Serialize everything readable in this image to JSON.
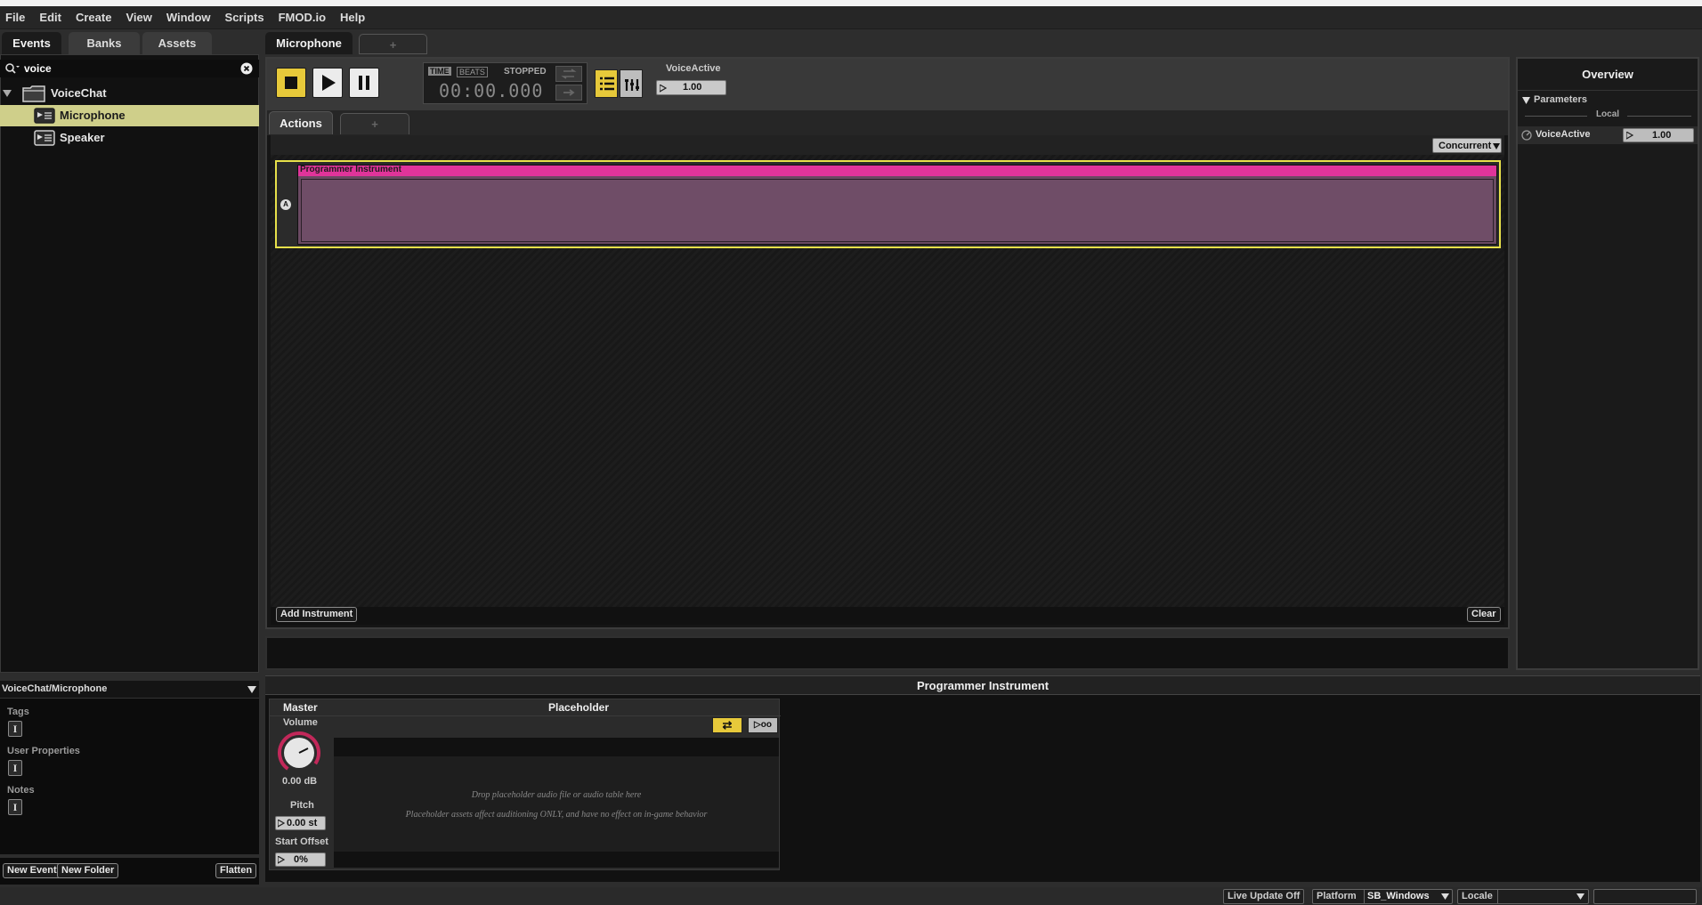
{
  "menu": [
    "File",
    "Edit",
    "Create",
    "View",
    "Window",
    "Scripts",
    "FMOD.io",
    "Help"
  ],
  "browser": {
    "tabs": [
      "Events",
      "Banks",
      "Assets"
    ],
    "search_value": "voice",
    "tree": [
      {
        "label": "VoiceChat",
        "type": "folder"
      },
      {
        "label": "Microphone",
        "type": "event",
        "selected": true
      },
      {
        "label": "Speaker",
        "type": "event"
      }
    ]
  },
  "properties": {
    "path": "VoiceChat/Microphone",
    "tags_label": "Tags",
    "user_props_label": "User Properties",
    "notes_label": "Notes",
    "prop_btn_glyph": "I"
  },
  "browser_footer": {
    "new_event": "New Event",
    "new_folder": "New Folder",
    "flatten": "Flatten"
  },
  "editor": {
    "tab_label": "Microphone",
    "add_tab": "+",
    "time_label": "TIME",
    "beats_label": "BEATS",
    "state": "STOPPED",
    "time_value": "00:00.000",
    "param_name": "VoiceActive",
    "param_value": "1.00",
    "sheet_tab": "Actions",
    "sheet_add": "+",
    "mode": "Concurrent",
    "row_letter": "A",
    "instrument_name": "Programmer Instrument",
    "add_instrument": "Add Instrument",
    "clear": "Clear"
  },
  "overview": {
    "title": "Overview",
    "section": "Parameters",
    "scope": "Local",
    "param_name": "VoiceActive",
    "param_value": "1.00"
  },
  "deck": {
    "title": "Programmer Instrument",
    "master_label": "Master",
    "placeholder_label": "Placeholder",
    "volume_label": "Volume",
    "volume_value": "0.00 dB",
    "pitch_label": "Pitch",
    "pitch_value": "0.00 st",
    "start_offset_label": "Start Offset",
    "start_offset_value": "0%",
    "loop_glyph": "⇄",
    "inf_glyph": "▷oo",
    "drop_text": "Drop placeholder audio file or audio table here",
    "note_text": "Placeholder assets affect auditioning ONLY, and have no effect on in-game behavior"
  },
  "status": {
    "live_update": "Live Update Off",
    "platform_label": "Platform",
    "platform_value": "SB_Windows",
    "locale_label": "Locale",
    "locale_value": ""
  },
  "colors": {
    "accent_yellow": "#e7c93a",
    "instrument_pink": "#e0349a",
    "instrument_body": "#6a4a62",
    "selection": "#cfcf8a",
    "knob_red": "#c2285a"
  }
}
